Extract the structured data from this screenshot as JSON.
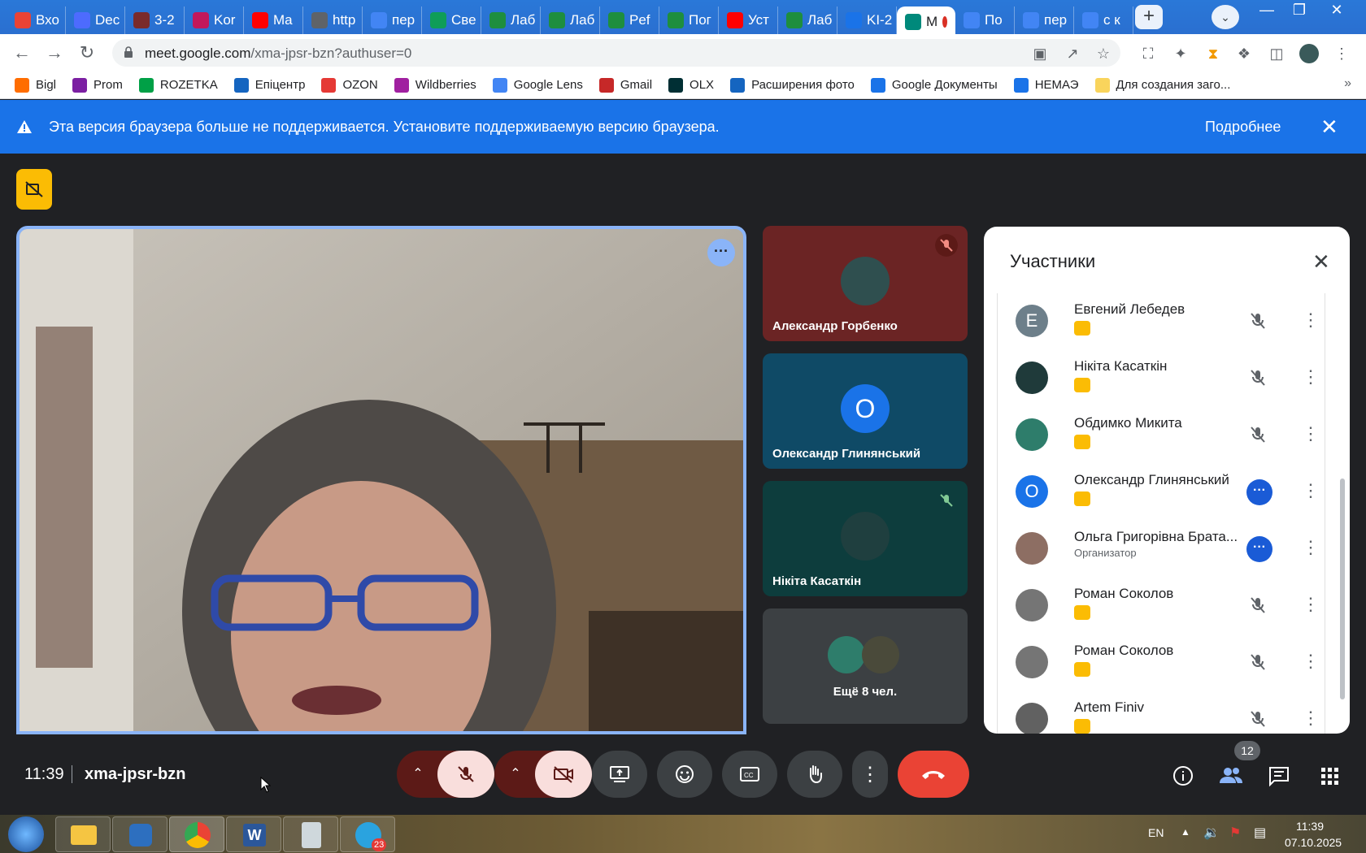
{
  "browser": {
    "tabs": [
      {
        "label": "Вхо",
        "icon": "gmail-icon",
        "color": "#ea4335"
      },
      {
        "label": "Dec",
        "icon": "deepseek-icon",
        "color": "#4d6bfe"
      },
      {
        "label": "3-2",
        "icon": "shield-icon",
        "color": "#7a2b2b"
      },
      {
        "label": "Kor",
        "icon": "feather-icon",
        "color": "#c2185b"
      },
      {
        "label": "Ma",
        "icon": "youtube-icon",
        "color": "#ff0000"
      },
      {
        "label": "http",
        "icon": "globe-icon",
        "color": "#5f6368"
      },
      {
        "label": "пер",
        "icon": "google-icon",
        "color": "#4285f4"
      },
      {
        "label": "Све",
        "icon": "classroom-icon",
        "color": "#0f9d58"
      },
      {
        "label": "Лаб",
        "icon": "drive-icon",
        "color": "#1e8e3e"
      },
      {
        "label": "Лаб",
        "icon": "drive-icon",
        "color": "#1e8e3e"
      },
      {
        "label": "Pef",
        "icon": "drive-icon",
        "color": "#1e8e3e"
      },
      {
        "label": "Пог",
        "icon": "drive-icon",
        "color": "#1e8e3e"
      },
      {
        "label": "Уст",
        "icon": "youtube-icon",
        "color": "#ff0000"
      },
      {
        "label": "Лаб",
        "icon": "drive-icon",
        "color": "#1e8e3e"
      },
      {
        "label": "KI-2",
        "icon": "contacts-icon",
        "color": "#1a73e8"
      },
      {
        "label": "M",
        "icon": "meet-icon",
        "color": "#00897b",
        "active": true
      },
      {
        "label": "По",
        "icon": "google-icon",
        "color": "#4285f4"
      },
      {
        "label": "пер",
        "icon": "google-icon",
        "color": "#4285f4"
      },
      {
        "label": "с к",
        "icon": "google-icon",
        "color": "#4285f4"
      }
    ],
    "new_tab": "+",
    "url_host": "meet.google.com",
    "url_path": "/xma-jpsr-bzn?authuser=0"
  },
  "bookmarks": [
    {
      "label": "Bigl",
      "color": "#ff6d00"
    },
    {
      "label": "Prom",
      "color": "#7b1fa2"
    },
    {
      "label": "ROZETKA",
      "color": "#00a046"
    },
    {
      "label": "Епіцентр",
      "color": "#1565c0"
    },
    {
      "label": "OZON",
      "color": "#e53935"
    },
    {
      "label": "Wildberries",
      "color": "#a020a0"
    },
    {
      "label": "Google Lens",
      "color": "#4285f4"
    },
    {
      "label": "Gmail",
      "color": "#c62828"
    },
    {
      "label": "OLX",
      "color": "#002f34"
    },
    {
      "label": "Расширения фото",
      "color": "#1565c0"
    },
    {
      "label": "Google Документы",
      "color": "#1a73e8"
    },
    {
      "label": "НЕМАЭ",
      "color": "#1a73e8"
    },
    {
      "label": "Для создания заго...",
      "color": "#f9d45c"
    }
  ],
  "banner": {
    "text": "Эта версия браузера больше не поддерживается. Установите поддерживаемую версию браузера.",
    "more": "Подробнее"
  },
  "tiles": [
    {
      "name": "Александр Горбенко",
      "bg": "#6b2424",
      "avatar_color": "#2f4f4f",
      "muted": true
    },
    {
      "name": "Олександр Глинянський",
      "bg": "#0f4a66",
      "avatar_color": "#1a73e8",
      "letter": "О"
    },
    {
      "name": "Нікіта Касаткін",
      "bg": "#0d3d3d",
      "avatar_color": "#1f3f3f",
      "muted": true
    },
    {
      "more_label": "Ещё 8 чел.",
      "bg": "#3c4043"
    }
  ],
  "panel": {
    "title": "Участники",
    "participants": [
      {
        "name": "Евгений Лебедев",
        "letter": "Е",
        "avatar_color": "#6d7f8a",
        "status": "muted"
      },
      {
        "name": "Нікіта Касаткін",
        "letter": "",
        "avatar_color": "#1f3a3a",
        "status": "muted"
      },
      {
        "name": "Обдимко Микита",
        "letter": "",
        "avatar_color": "#2e7d6b",
        "status": "muted"
      },
      {
        "name": "Олександр Глинянський",
        "letter": "О",
        "avatar_color": "#1a73e8",
        "status": "talking"
      },
      {
        "name": "Ольга Григорівна Брата...",
        "letter": "",
        "avatar_color": "#8d6e63",
        "status": "talking",
        "role": "Организатор"
      },
      {
        "name": "Роман Соколов",
        "letter": "",
        "avatar_color": "#757575",
        "status": "muted"
      },
      {
        "name": "Роман Соколов",
        "letter": "",
        "avatar_color": "#757575",
        "status": "muted"
      },
      {
        "name": "Artem Finiv",
        "letter": "",
        "avatar_color": "#616161",
        "status": "muted"
      }
    ]
  },
  "meeting": {
    "time": "11:39",
    "code": "xma-jpsr-bzn",
    "participants_count": "12"
  },
  "taskbar": {
    "lang": "EN",
    "time": "11:39",
    "date": "07.10.2025",
    "telegram_badge": "23"
  }
}
